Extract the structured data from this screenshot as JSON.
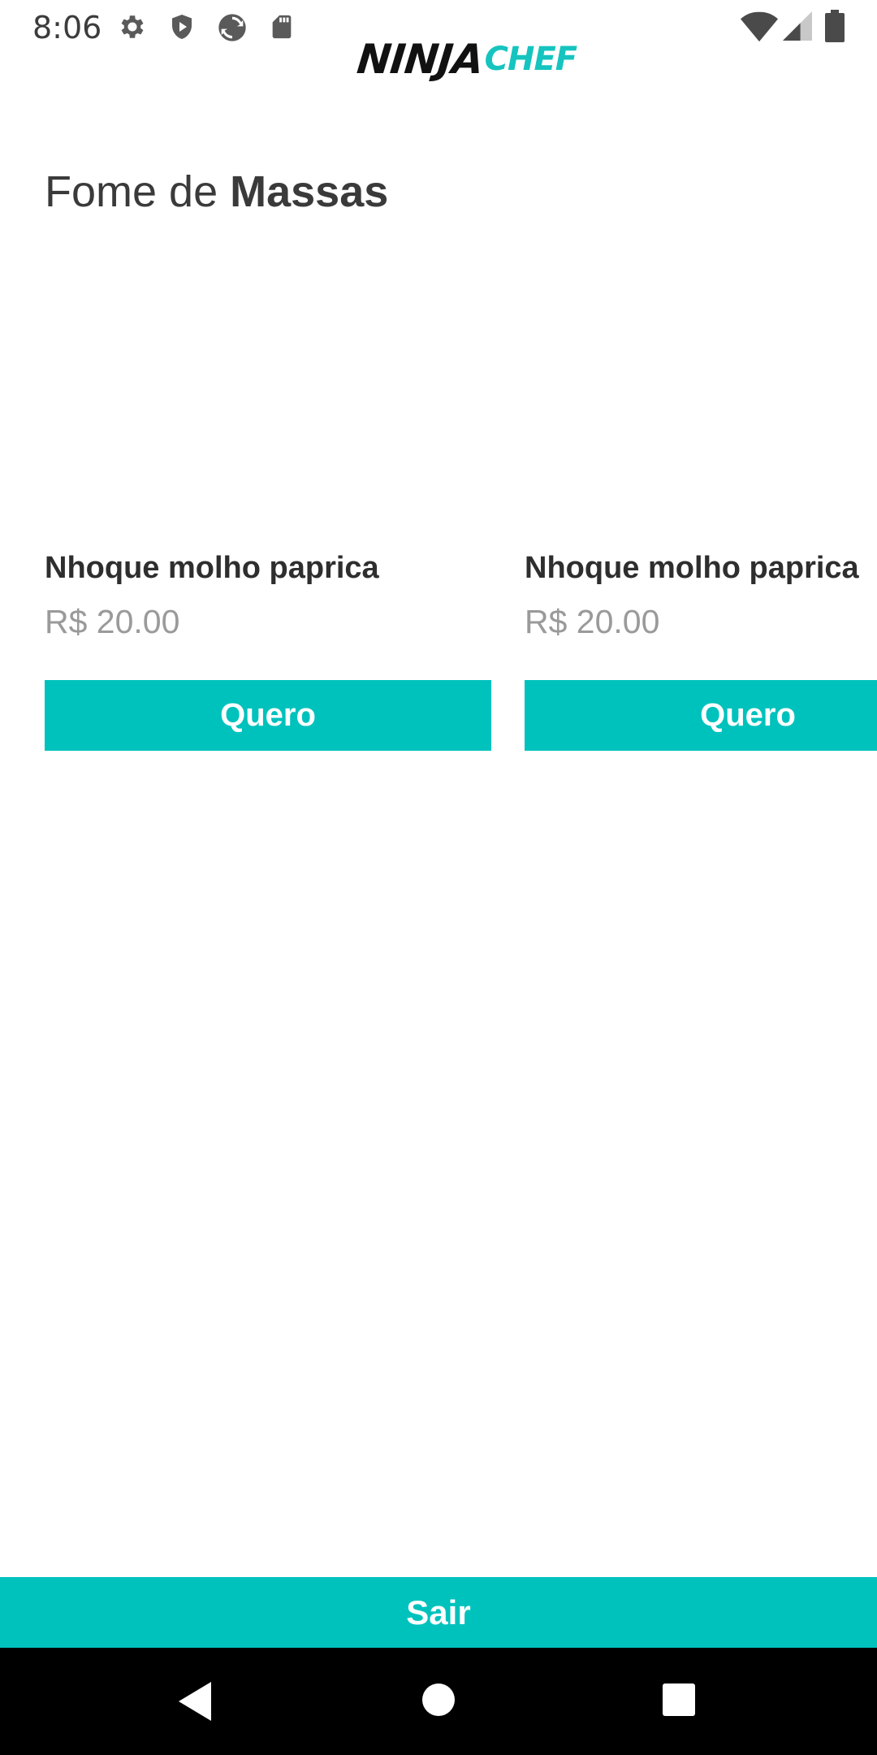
{
  "status_bar": {
    "time": "8:06",
    "icons": [
      "settings-icon",
      "shield-icon",
      "sync-icon",
      "sd-card-icon",
      "wifi-icon",
      "signal-icon",
      "battery-icon"
    ]
  },
  "header": {
    "logo_part1": "NINJA",
    "logo_part2": "CHEF"
  },
  "page": {
    "title_prefix": "Fome de ",
    "title_bold": "Massas"
  },
  "products": [
    {
      "name": "Nhoque molho paprica",
      "price": "R$ 20.00",
      "button_label": "Quero"
    },
    {
      "name": "Nhoque molho paprica",
      "price": "R$ 20.00",
      "button_label": "Quero"
    }
  ],
  "footer": {
    "exit_label": "Sair"
  },
  "colors": {
    "accent": "#00c2bd",
    "logo_accent": "#15c4bf",
    "title_text": "#3a3a3a",
    "price_text": "#9a9a9a",
    "nav_bar": "#000000"
  },
  "nav_bar": {
    "icons": [
      "back-icon",
      "home-icon",
      "recents-icon"
    ]
  }
}
